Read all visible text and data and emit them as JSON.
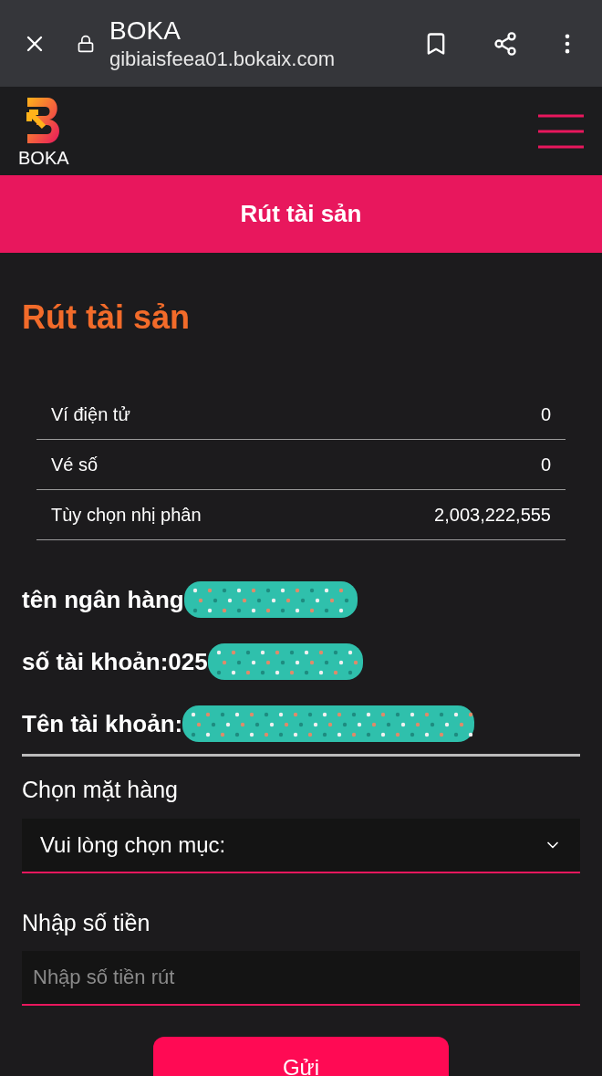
{
  "browser_bar": {
    "title": "BOKA",
    "url": "gibiaisfeea01.bokaix.com"
  },
  "header": {
    "logo_text": "BOKA"
  },
  "banner": {
    "title": "Rút tài sản"
  },
  "page_title": "Rút tài sản",
  "balances": [
    {
      "label": "Ví điện tử",
      "value": "0"
    },
    {
      "label": "Vé số",
      "value": "0"
    },
    {
      "label": "Tùy chọn nhị phân",
      "value": "2,003,222,555"
    }
  ],
  "account_info": [
    {
      "text": "tên ngân hàng"
    },
    {
      "text": "số tài khoản:025"
    },
    {
      "text": "Tên tài khoản:"
    }
  ],
  "item_select": {
    "label": "Chọn mặt hàng",
    "value": "Vui lòng chọn mục:"
  },
  "amount_field": {
    "label": "Nhập số tiền",
    "placeholder": "Nhập số tiền rút"
  },
  "submit_button": "Gửi"
}
